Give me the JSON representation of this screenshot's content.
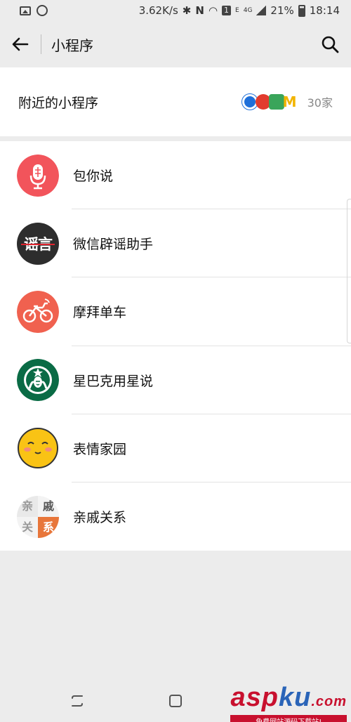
{
  "status": {
    "speed": "3.62K/s",
    "network_e": "E",
    "network_4g": "4G",
    "battery": "21%",
    "time": "18:14",
    "badge": "1"
  },
  "header": {
    "title": "小程序",
    "back_icon": "back-arrow-icon",
    "search_icon": "search-icon"
  },
  "nearby": {
    "label": "附近的小程序",
    "count": "30家"
  },
  "apps": [
    {
      "name": "包你说",
      "icon": "microphone-icon",
      "color": "#f2545b"
    },
    {
      "name": "微信辟谣助手",
      "icon": "rumor-icon",
      "icon_text": "谣言",
      "color": "#2d2d2d"
    },
    {
      "name": "摩拜单车",
      "icon": "bike-icon",
      "color": "#f0614f"
    },
    {
      "name": "星巴克用星说",
      "icon": "starbucks-icon",
      "color": "#0a6b45"
    },
    {
      "name": "表情家园",
      "icon": "smiley-face-icon",
      "color": "#f9c315"
    },
    {
      "name": "亲戚关系",
      "icon": "relatives-icon",
      "icon_text": [
        "亲",
        "戚",
        "关",
        "系"
      ],
      "color": "#e8763a"
    }
  ],
  "nav": {
    "recents_icon": "recents-icon",
    "home_icon": "home-icon"
  },
  "watermark": {
    "main_a": "asp",
    "main_b": "ku",
    "main_c": ".com",
    "sub": "免费网站源码下载站!"
  }
}
